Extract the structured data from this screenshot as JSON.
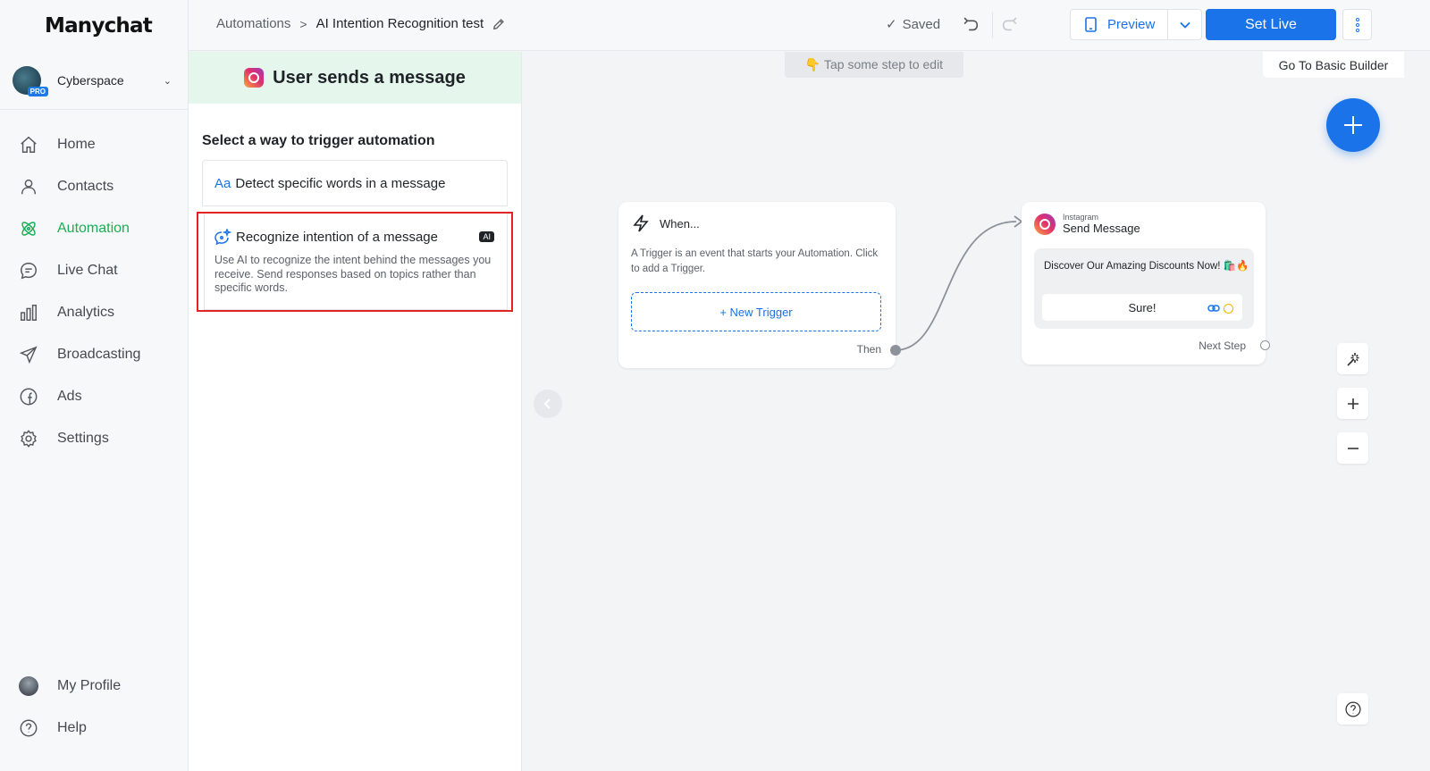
{
  "brand": {
    "logo": "Manychat"
  },
  "workspace": {
    "name": "Cyberspace",
    "badge": "PRO"
  },
  "nav": {
    "items": [
      {
        "label": "Home",
        "icon": "home-icon"
      },
      {
        "label": "Contacts",
        "icon": "user-icon"
      },
      {
        "label": "Automation",
        "icon": "atom-icon",
        "active": true
      },
      {
        "label": "Live Chat",
        "icon": "chat-icon"
      },
      {
        "label": "Analytics",
        "icon": "bar-chart-icon"
      },
      {
        "label": "Broadcasting",
        "icon": "send-icon"
      },
      {
        "label": "Ads",
        "icon": "facebook-icon"
      },
      {
        "label": "Settings",
        "icon": "gear-icon"
      }
    ],
    "bottom": [
      {
        "label": "My Profile",
        "icon": "avatar"
      },
      {
        "label": "Help",
        "icon": "help-icon"
      }
    ]
  },
  "topbar": {
    "breadcrumb_root": "Automations",
    "breadcrumb_sep": ">",
    "breadcrumb_current": "AI Intention Recognition test",
    "saved_check": "✓",
    "saved_label": "Saved",
    "preview_label": "Preview",
    "setlive_label": "Set Live"
  },
  "panel": {
    "title": "User sends a message",
    "subtitle": "Select a way to trigger automation",
    "option1": {
      "prefix": "Aa",
      "label": "Detect specific words in a message"
    },
    "option2": {
      "label": "Recognize intention of a message",
      "badge": "AI",
      "description": "Use AI to recognize the intent behind the messages you receive. Send responses based on topics rather than specific words."
    }
  },
  "canvas": {
    "tap_hint": "👇 Tap some step to edit",
    "basic_builder": "Go To Basic Builder",
    "when_node": {
      "title": "When...",
      "description": "A Trigger is an event that starts your Automation. Click to add a Trigger.",
      "new_trigger": "+ New Trigger",
      "then": "Then"
    },
    "send_node": {
      "platform": "Instagram",
      "title": "Send Message",
      "message": "Discover Our Amazing Discounts Now! 🛍️🔥",
      "button": "Sure!",
      "next": "Next Step"
    }
  },
  "colors": {
    "accent": "#1a73e8",
    "active_nav": "#1aae55",
    "highlight": "#e02424"
  }
}
